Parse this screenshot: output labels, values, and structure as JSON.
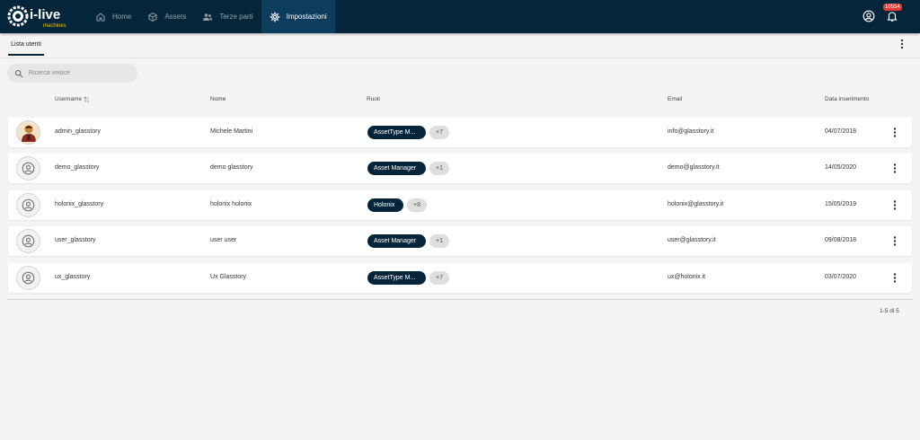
{
  "brand": {
    "logo_text": "i-live",
    "logo_sub": "machines",
    "colors": {
      "topbar": "#05263a",
      "active_nav": "#0d3d5c",
      "chip": "#05263a",
      "badge": "#e53935",
      "logo_yellow": "#f5c400"
    }
  },
  "nav": [
    {
      "label": "Home",
      "icon": "home-icon",
      "active": false
    },
    {
      "label": "Assets",
      "icon": "cube-icon",
      "active": false
    },
    {
      "label": "Terze parti",
      "icon": "people-icon",
      "active": false
    },
    {
      "label": "Impostazioni",
      "icon": "gear-icon",
      "active": true
    }
  ],
  "topbar": {
    "account_icon": "account-circle-icon",
    "notification_icon": "bell-icon",
    "notification_count": "10554"
  },
  "subheader": {
    "tab_label": "Lista utenti",
    "menu_icon": "more-vertical-icon"
  },
  "search": {
    "placeholder": "Ricerca veloce",
    "value": ""
  },
  "table": {
    "columns": {
      "username": "Username",
      "name": "Nome",
      "roles": "Ruoli",
      "email": "Email",
      "date": "Data inserimento"
    },
    "rows": [
      {
        "username": "admin_glasstory",
        "name": "Michele Martini",
        "role": "AssetType M...",
        "more_roles": "+7",
        "email": "info@glasstory.it",
        "date": "04/07/2018",
        "avatar": "photo"
      },
      {
        "username": "demo_glasstory",
        "name": "demo glasstory",
        "role": "Asset Manager",
        "more_roles": "+1",
        "email": "demo@glasstory.it",
        "date": "14/05/2020",
        "avatar": "placeholder"
      },
      {
        "username": "holonix_glasstory",
        "name": "holonix holonix",
        "role": "Holonix",
        "more_roles": "+8",
        "email": "holonix@glasstory.it",
        "date": "15/05/2019",
        "avatar": "placeholder"
      },
      {
        "username": "user_glasstory",
        "name": "user user",
        "role": "Asset Manager",
        "more_roles": "+1",
        "email": "user@glasstory.it",
        "date": "09/08/2018",
        "avatar": "placeholder"
      },
      {
        "username": "ux_glasstory",
        "name": "Ux Glasstory",
        "role": "AssetType M...",
        "more_roles": "+7",
        "email": "ux@holonix.it",
        "date": "03/07/2020",
        "avatar": "placeholder"
      }
    ]
  },
  "pagination": {
    "label": "1-5 di 5"
  }
}
